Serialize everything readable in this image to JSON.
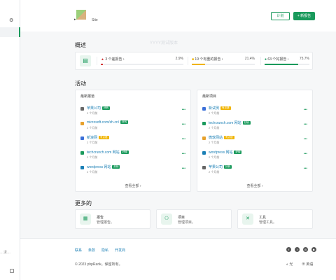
{
  "sidebar": {
    "truncated_text": "…求…"
  },
  "header": {
    "site_name": "Site",
    "plan_button": "计划",
    "new_report_button": "+ 新报告",
    "watermark": "YYYY测试版本"
  },
  "overview": {
    "title": "概述",
    "items": [
      {
        "label": "3 个差报告 ›",
        "pct": "2.9%",
        "color": "#d43a3a",
        "fraction": 0.029
      },
      {
        "label": "19 个有重的报告 ›",
        "pct": "21.4%",
        "color": "#f0b400",
        "fraction": 0.214
      },
      {
        "label": "63 个好报告 ›",
        "pct": "75.7%",
        "color": "#1a9a5c",
        "fraction": 0.757
      }
    ]
  },
  "activity": {
    "title": "活动",
    "left": {
      "heading": "最新报道",
      "view_all": "查看全部 ›",
      "rows": [
        {
          "name": "苹果公司",
          "tag": "好转",
          "tagcolor": "#1a9a5c",
          "time": "2 个月前",
          "icon_color": "#666"
        },
        {
          "name": "microsoft.com/zh-cn/",
          "tag": "好转",
          "tagcolor": "#1a9a5c",
          "time": "2 个月前",
          "icon_color": "#e7a12c"
        },
        {
          "name": "新浪网",
          "tag": "有点错",
          "tagcolor": "#f0b400",
          "time": "2 个月前",
          "icon_color": "#3a6fd8"
        },
        {
          "name": "techcrunch.com 网站",
          "tag": "好转",
          "tagcolor": "#1a9a5c",
          "time": "2 个月前",
          "icon_color": "#1a9a5c"
        },
        {
          "name": "wordpress 网站",
          "tag": "好转",
          "tagcolor": "#1a9a5c",
          "time": "2 个月前",
          "icon_color": "#1a7fb5"
        }
      ]
    },
    "right": {
      "heading": "最新项目",
      "view_all": "查看全部 ›",
      "rows": [
        {
          "name": "新试例",
          "tag": "有点错",
          "tagcolor": "#f0b400",
          "time": "2 个月前",
          "icon_color": "#3a6fd8"
        },
        {
          "name": "techcrunch.com 网站",
          "tag": "好转",
          "tagcolor": "#1a9a5c",
          "time": "2 个月前",
          "icon_color": "#1a9a5c"
        },
        {
          "name": "微软网站",
          "tag": "有点错",
          "tagcolor": "#f0b400",
          "time": "2 个月前",
          "icon_color": "#e7a12c"
        },
        {
          "name": "wordpress 网站",
          "tag": "好转",
          "tagcolor": "#1a9a5c",
          "time": "2 个月前",
          "icon_color": "#1a7fb5"
        },
        {
          "name": "苹果公司",
          "tag": "好转",
          "tagcolor": "#1a9a5c",
          "time": "2 个月前",
          "icon_color": "#666"
        }
      ]
    },
    "row_dots": "•••"
  },
  "more": {
    "title": "更多的",
    "cards": [
      {
        "title": "报告",
        "desc": "管理报告。",
        "icon": "report-icon"
      },
      {
        "title": "项目",
        "desc": "管理项目。",
        "icon": "project-icon"
      },
      {
        "title": "工具",
        "desc": "管理工具。",
        "icon": "tools-icon"
      }
    ]
  },
  "footer": {
    "links": [
      "联系",
      "条款",
      "隐私",
      "开发商"
    ],
    "copyright": "© 2023 phpRank。保留所有。",
    "theme": "◐ 光",
    "language": "⊕ 英语"
  }
}
